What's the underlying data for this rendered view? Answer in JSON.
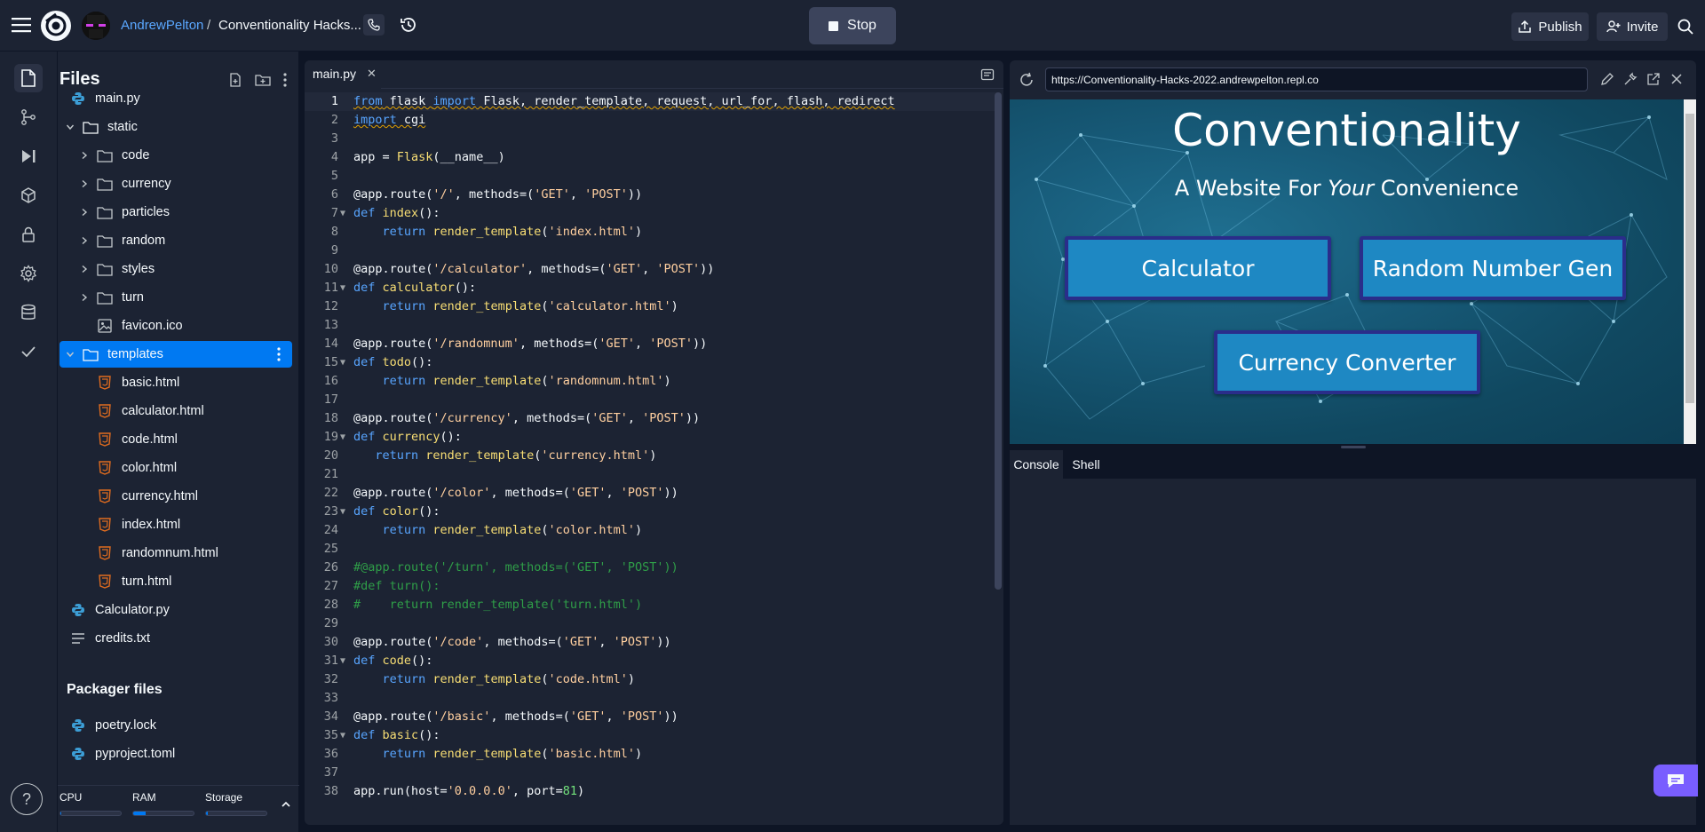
{
  "topbar": {
    "user": "AndrewPelton",
    "separator": "/",
    "repl_name": "Conventionality Hacks...",
    "stop_label": "Stop",
    "publish_label": "Publish",
    "invite_label": "Invite"
  },
  "files_panel": {
    "title": "Files",
    "tree": [
      {
        "label": "main.py",
        "type": "python",
        "depth": 0
      },
      {
        "label": "static",
        "type": "folder-open",
        "depth": 0
      },
      {
        "label": "code",
        "type": "folder",
        "depth": 1
      },
      {
        "label": "currency",
        "type": "folder",
        "depth": 1
      },
      {
        "label": "particles",
        "type": "folder",
        "depth": 1
      },
      {
        "label": "random",
        "type": "folder",
        "depth": 1
      },
      {
        "label": "styles",
        "type": "folder",
        "depth": 1
      },
      {
        "label": "turn",
        "type": "folder",
        "depth": 1
      },
      {
        "label": "favicon.ico",
        "type": "image",
        "depth": 1
      },
      {
        "label": "templates",
        "type": "folder-open",
        "depth": 0,
        "selected": true
      },
      {
        "label": "basic.html",
        "type": "html",
        "depth": 1
      },
      {
        "label": "calculator.html",
        "type": "html",
        "depth": 1
      },
      {
        "label": "code.html",
        "type": "html",
        "depth": 1
      },
      {
        "label": "color.html",
        "type": "html",
        "depth": 1
      },
      {
        "label": "currency.html",
        "type": "html",
        "depth": 1
      },
      {
        "label": "index.html",
        "type": "html",
        "depth": 1
      },
      {
        "label": "randomnum.html",
        "type": "html",
        "depth": 1
      },
      {
        "label": "turn.html",
        "type": "html",
        "depth": 1
      },
      {
        "label": "Calculator.py",
        "type": "python",
        "depth": 0
      },
      {
        "label": "credits.txt",
        "type": "text",
        "depth": 0
      }
    ],
    "packager_title": "Packager files",
    "packager": [
      {
        "label": "poetry.lock",
        "type": "python"
      },
      {
        "label": "pyproject.toml",
        "type": "python"
      }
    ],
    "resources": {
      "cpu_label": "CPU",
      "cpu_usage": 0.02,
      "ram_label": "RAM",
      "ram_usage": 0.2,
      "storage_label": "Storage",
      "storage_usage": 0.03
    }
  },
  "editor": {
    "tab_label": "main.py",
    "current_line": 1,
    "lines": [
      [
        [
          "kw squig",
          "from"
        ],
        [
          "squig",
          " flask "
        ],
        [
          "kw squig",
          "import"
        ],
        [
          "squig",
          " Flask, render_template, request, url_for, flash, redirect"
        ]
      ],
      [
        [
          "kw squig",
          "import"
        ],
        [
          "squig",
          " cgi"
        ]
      ],
      [],
      [
        [
          "",
          "app = "
        ],
        [
          "call",
          "Flask"
        ],
        [
          "",
          "(__name__)"
        ]
      ],
      [],
      [
        [
          "",
          "@app.route("
        ],
        [
          "str",
          "'/'"
        ],
        [
          "",
          ", methods=("
        ],
        [
          "str",
          "'GET'"
        ],
        [
          "",
          ", "
        ],
        [
          "str",
          "'POST'"
        ],
        [
          "",
          "))"
        ]
      ],
      [
        [
          "kw",
          "def"
        ],
        [
          "call",
          " index"
        ],
        [
          "",
          "():"
        ]
      ],
      [
        [
          "",
          "    "
        ],
        [
          "kw",
          "return"
        ],
        [
          "call",
          " render_template"
        ],
        [
          "",
          "("
        ],
        [
          "str",
          "'index.html'"
        ],
        [
          "",
          ")"
        ]
      ],
      [],
      [
        [
          "",
          "@app.route("
        ],
        [
          "str",
          "'/calculator'"
        ],
        [
          "",
          ", methods=("
        ],
        [
          "str",
          "'GET'"
        ],
        [
          "",
          ", "
        ],
        [
          "str",
          "'POST'"
        ],
        [
          "",
          "))"
        ]
      ],
      [
        [
          "kw",
          "def"
        ],
        [
          "call",
          " calculator"
        ],
        [
          "",
          "():"
        ]
      ],
      [
        [
          "",
          "    "
        ],
        [
          "kw",
          "return"
        ],
        [
          "call",
          " render_template"
        ],
        [
          "",
          "("
        ],
        [
          "str",
          "'calculator.html'"
        ],
        [
          "",
          ")"
        ]
      ],
      [],
      [
        [
          "",
          "@app.route("
        ],
        [
          "str",
          "'/randomnum'"
        ],
        [
          "",
          ", methods=("
        ],
        [
          "str",
          "'GET'"
        ],
        [
          "",
          ", "
        ],
        [
          "str",
          "'POST'"
        ],
        [
          "",
          "))"
        ]
      ],
      [
        [
          "kw",
          "def"
        ],
        [
          "call",
          " todo"
        ],
        [
          "",
          "():"
        ]
      ],
      [
        [
          "",
          "    "
        ],
        [
          "kw",
          "return"
        ],
        [
          "call",
          " render_template"
        ],
        [
          "",
          "("
        ],
        [
          "str",
          "'randomnum.html'"
        ],
        [
          "",
          ")"
        ]
      ],
      [],
      [
        [
          "",
          "@app.route("
        ],
        [
          "str",
          "'/currency'"
        ],
        [
          "",
          ", methods=("
        ],
        [
          "str",
          "'GET'"
        ],
        [
          "",
          ", "
        ],
        [
          "str",
          "'POST'"
        ],
        [
          "",
          "))"
        ]
      ],
      [
        [
          "kw",
          "def"
        ],
        [
          "call",
          " currency"
        ],
        [
          "",
          "():"
        ]
      ],
      [
        [
          "",
          "   "
        ],
        [
          "kw",
          "return"
        ],
        [
          "call",
          " render_template"
        ],
        [
          "",
          "("
        ],
        [
          "str",
          "'currency.html'"
        ],
        [
          "",
          ")"
        ]
      ],
      [],
      [
        [
          "",
          "@app.route("
        ],
        [
          "str",
          "'/color'"
        ],
        [
          "",
          ", methods=("
        ],
        [
          "str",
          "'GET'"
        ],
        [
          "",
          ", "
        ],
        [
          "str",
          "'POST'"
        ],
        [
          "",
          "))"
        ]
      ],
      [
        [
          "kw",
          "def"
        ],
        [
          "call",
          " color"
        ],
        [
          "",
          "():"
        ]
      ],
      [
        [
          "",
          "    "
        ],
        [
          "kw",
          "return"
        ],
        [
          "call",
          " render_template"
        ],
        [
          "",
          "("
        ],
        [
          "str",
          "'color.html'"
        ],
        [
          "",
          ")"
        ]
      ],
      [],
      [
        [
          "com",
          "#@app.route('/turn', methods=('GET', 'POST'))"
        ]
      ],
      [
        [
          "com",
          "#def turn():"
        ]
      ],
      [
        [
          "com",
          "#    return render_template('turn.html')"
        ]
      ],
      [],
      [
        [
          "",
          "@app.route("
        ],
        [
          "str",
          "'/code'"
        ],
        [
          "",
          ", methods=("
        ],
        [
          "str",
          "'GET'"
        ],
        [
          "",
          ", "
        ],
        [
          "str",
          "'POST'"
        ],
        [
          "",
          "))"
        ]
      ],
      [
        [
          "kw",
          "def"
        ],
        [
          "call",
          " code"
        ],
        [
          "",
          "():"
        ]
      ],
      [
        [
          "",
          "    "
        ],
        [
          "kw",
          "return"
        ],
        [
          "call",
          " render_template"
        ],
        [
          "",
          "("
        ],
        [
          "str",
          "'code.html'"
        ],
        [
          "",
          ")"
        ]
      ],
      [],
      [
        [
          "",
          "@app.route("
        ],
        [
          "str",
          "'/basic'"
        ],
        [
          "",
          ", methods=("
        ],
        [
          "str",
          "'GET'"
        ],
        [
          "",
          ", "
        ],
        [
          "str",
          "'POST'"
        ],
        [
          "",
          "))"
        ]
      ],
      [
        [
          "kw",
          "def"
        ],
        [
          "call",
          " basic"
        ],
        [
          "",
          "():"
        ]
      ],
      [
        [
          "",
          "    "
        ],
        [
          "kw",
          "return"
        ],
        [
          "call",
          " render_template"
        ],
        [
          "",
          "("
        ],
        [
          "str",
          "'basic.html'"
        ],
        [
          "",
          ")"
        ]
      ],
      [],
      [
        [
          "",
          "app.run(host="
        ],
        [
          "str",
          "'0.0.0.0'"
        ],
        [
          "",
          ", port="
        ],
        [
          "num",
          "81"
        ],
        [
          "",
          ")"
        ]
      ]
    ],
    "fold_lines": [
      7,
      11,
      15,
      19,
      23,
      31,
      35
    ]
  },
  "webview": {
    "url": "https://Conventionality-Hacks-2022.andrewpelton.repl.co",
    "site_title": "Conventionality",
    "site_sub_pre": "A Website For ",
    "site_sub_em": "Your",
    "site_sub_post": " Convenience",
    "btn_calculator": "Calculator",
    "btn_random": "Random Number Gen",
    "btn_currency": "Currency Converter"
  },
  "console": {
    "tab_console": "Console",
    "tab_shell": "Shell"
  },
  "help_label": "?"
}
